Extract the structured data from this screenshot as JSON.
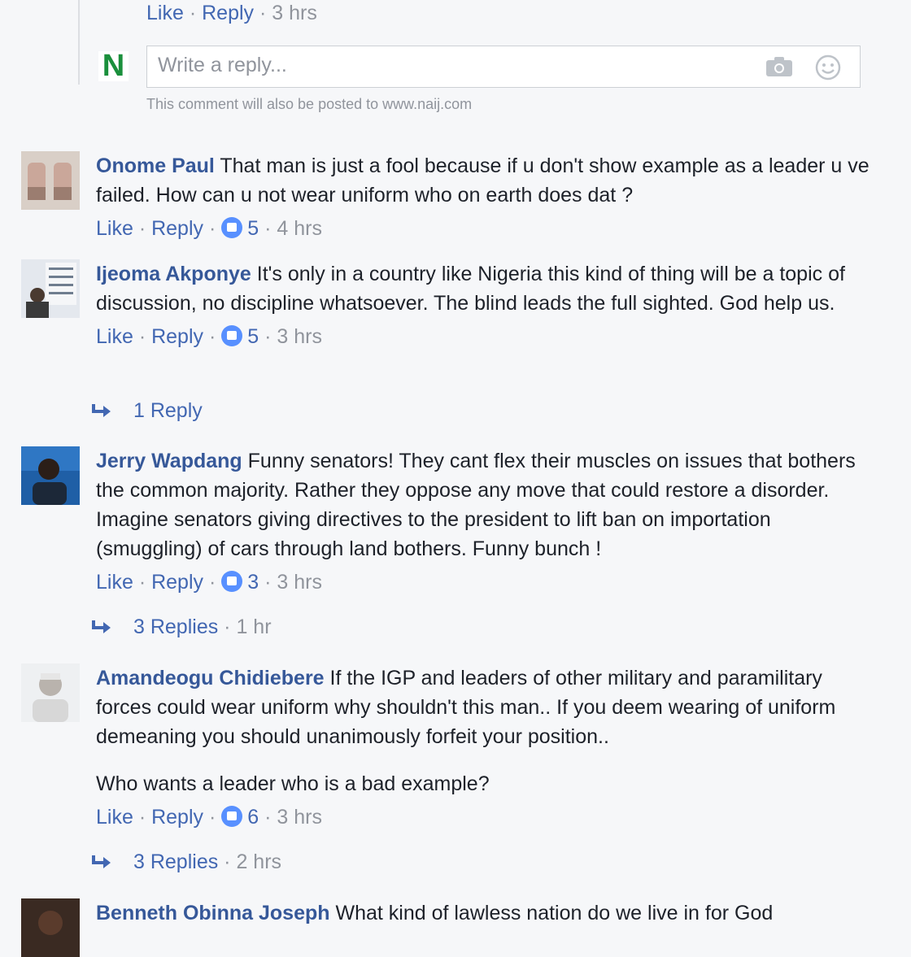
{
  "top_reply": {
    "like": "Like",
    "sep": "·",
    "reply": "Reply",
    "time": "3 hrs",
    "logo_letter": "N",
    "placeholder": "Write a reply...",
    "note": "This comment will also be posted to www.naij.com"
  },
  "comments": [
    {
      "name": "Onome Paul",
      "text": "That man is just a fool because if u don't show example as a leader u ve failed. How can u not wear uniform who on earth does dat ?",
      "like": "Like",
      "reply": "Reply",
      "likes": "5",
      "time": "4 hrs"
    },
    {
      "name": "Ijeoma Akponye",
      "text": "It's only in a country like Nigeria this kind of thing will be a topic of discussion, no discipline whatsoever. The blind leads the full sighted. God help us.",
      "like": "Like",
      "reply": "Reply",
      "likes": "5",
      "time": "3 hrs",
      "replies": "1 Reply",
      "replies_time": ""
    },
    {
      "name": "Jerry Wapdang",
      "text": "Funny senators! They cant flex their muscles on issues that bothers the common majority. Rather they oppose any move that could restore a disorder. Imagine senators giving directives to the president to lift ban on importation (smuggling) of cars through land bothers. Funny bunch !",
      "like": "Like",
      "reply": "Reply",
      "likes": "3",
      "time": "3 hrs",
      "replies": "3 Replies",
      "replies_time": "1 hr"
    },
    {
      "name": "Amandeogu Chidiebere",
      "text": "If the IGP and leaders of other military and paramilitary forces could wear uniform why shouldn't this man.. If you deem wearing of uniform demeaning you should unanimously forfeit your position..",
      "text2": "Who wants a leader who is a bad example?",
      "like": "Like",
      "reply": "Reply",
      "likes": "6",
      "time": "3 hrs",
      "replies": "3 Replies",
      "replies_time": "2 hrs"
    },
    {
      "name": "Benneth Obinna Joseph",
      "text": "What kind of lawless nation do we live in for God"
    }
  ],
  "colors": {
    "link": "#4267b2",
    "name": "#365899",
    "muted": "#90949c",
    "like_badge": "#5890ff"
  }
}
